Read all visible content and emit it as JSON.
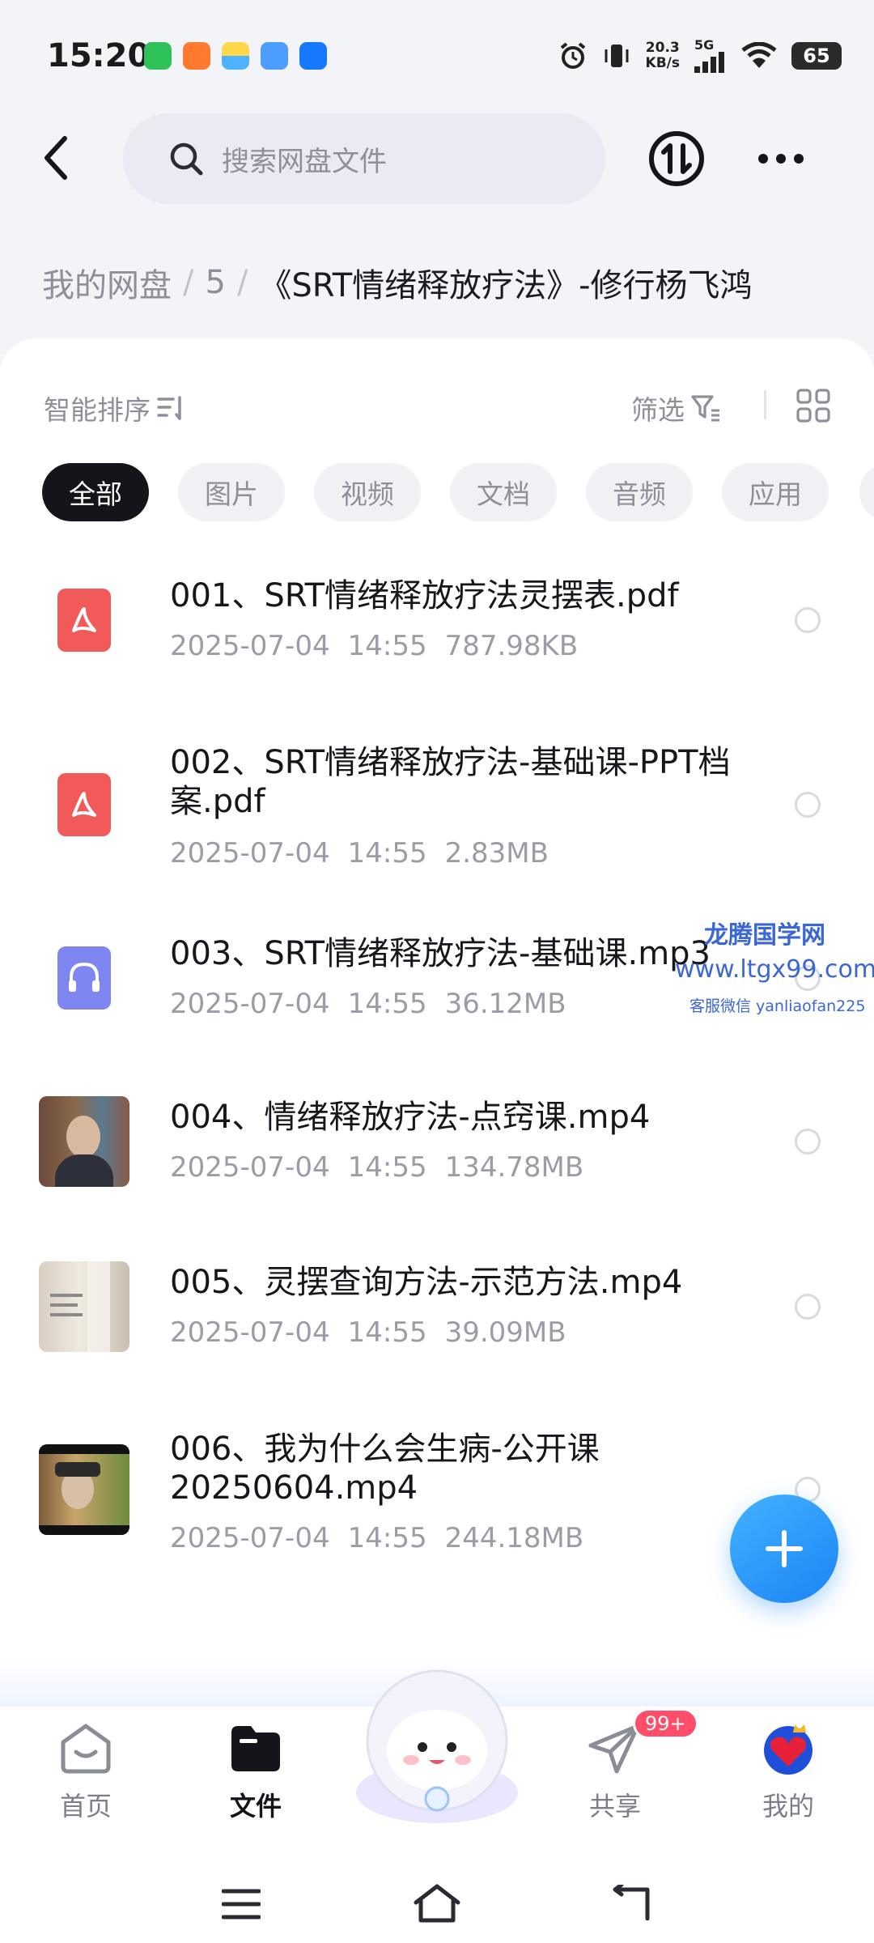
{
  "status_bar": {
    "time": "15:20",
    "net_speed_value": "20.3",
    "net_speed_unit": "KB/s",
    "network": "5G",
    "battery": "65"
  },
  "header": {
    "search_placeholder": "搜索网盘文件"
  },
  "breadcrumb": {
    "root": "我的网盘",
    "sep": "/",
    "level1": "5",
    "current": "《SRT情绪释放疗法》-修行杨飞鸿"
  },
  "toolbar": {
    "sort_label": "智能排序",
    "filter_label": "筛选"
  },
  "categories": [
    "全部",
    "图片",
    "视频",
    "文档",
    "音频",
    "应用"
  ],
  "files": [
    {
      "name": "001、SRT情绪释放疗法灵摆表.pdf",
      "date": "2025-07-04",
      "time": "14:55",
      "size": "787.98KB",
      "type": "pdf-icon"
    },
    {
      "name": "002、SRT情绪释放疗法-基础课-PPT档案.pdf",
      "date": "2025-07-04",
      "time": "14:55",
      "size": "2.83MB",
      "type": "pdf-icon"
    },
    {
      "name": "003、SRT情绪释放疗法-基础课.mp3",
      "date": "2025-07-04",
      "time": "14:55",
      "size": "36.12MB",
      "type": "audio-icon"
    },
    {
      "name": "004、情绪释放疗法-点窍课.mp4",
      "date": "2025-07-04",
      "time": "14:55",
      "size": "134.78MB",
      "type": "video-thumbnail"
    },
    {
      "name": "005、灵摆查询方法-示范方法.mp4",
      "date": "2025-07-04",
      "time": "14:55",
      "size": "39.09MB",
      "type": "video-thumbnail"
    },
    {
      "name": "006、我为什么会生病-公开课20250604.mp4",
      "date": "2025-07-04",
      "time": "14:55",
      "size": "244.18MB",
      "type": "video-thumbnail"
    }
  ],
  "watermark": {
    "line1": "龙腾国学网",
    "line2": "www.ltgx99.com",
    "line3": "客服微信 yanliaofan225"
  },
  "bottom_nav": {
    "home": "首页",
    "files": "文件",
    "share": "共享",
    "share_badge": "99+",
    "me": "我的"
  },
  "colors": {
    "accent": "#1c84f5",
    "pdf": "#f25a5a",
    "audio": "#7f86f2",
    "badge": "#ff4d6a"
  }
}
